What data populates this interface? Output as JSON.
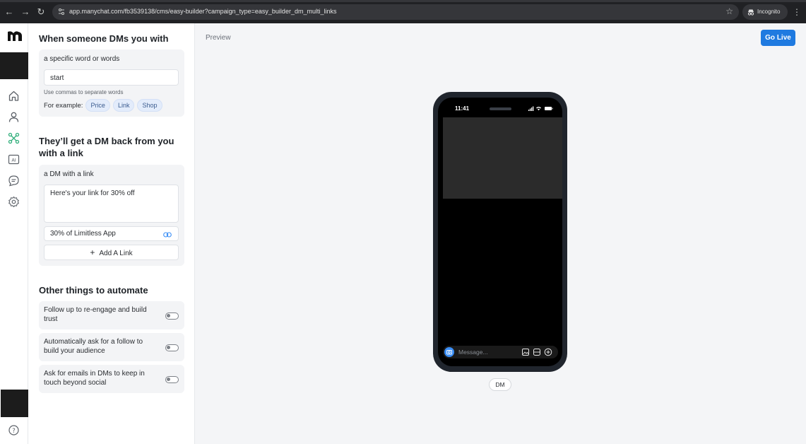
{
  "browser": {
    "url": "app.manychat.com/fb3539138/cms/easy-builder?campaign_type=easy_builder_dm_multi_links",
    "incognito_label": "Incognito",
    "back_icon": "←",
    "forward_icon": "→",
    "reload_icon": "↻",
    "star_icon": "☆",
    "menu_icon": "⋮"
  },
  "trigger": {
    "heading": "When someone DMs you with",
    "option_label": "a specific word or words",
    "keyword_value": "start",
    "hint": "Use commas to separate words",
    "example_label": "For example:",
    "examples": [
      "Price",
      "Link",
      "Shop"
    ]
  },
  "response": {
    "heading": "They’ll get a DM back from you with a link",
    "option_label": "a DM with a link",
    "message_text": "Here's your link for 30% off",
    "link_label": "30% of Limitless App",
    "add_link_label": "Add A Link",
    "add_link_icon": "+"
  },
  "automations": {
    "heading": "Other things to automate",
    "items": [
      {
        "label": "Follow up to re-engage and build trust",
        "enabled": false
      },
      {
        "label": "Automatically ask for a follow to build your audience",
        "enabled": false
      },
      {
        "label": "Ask for emails in DMs to keep in touch beyond social",
        "enabled": false
      }
    ]
  },
  "preview": {
    "label": "Preview",
    "go_live_label": "Go Live",
    "phone_time": "11:41",
    "message_placeholder": "Message...",
    "mode_label": "DM"
  },
  "colors": {
    "accent": "#1f7ae0",
    "chip_bg": "#e3ecfb",
    "rail_active": "#2fae7a"
  }
}
